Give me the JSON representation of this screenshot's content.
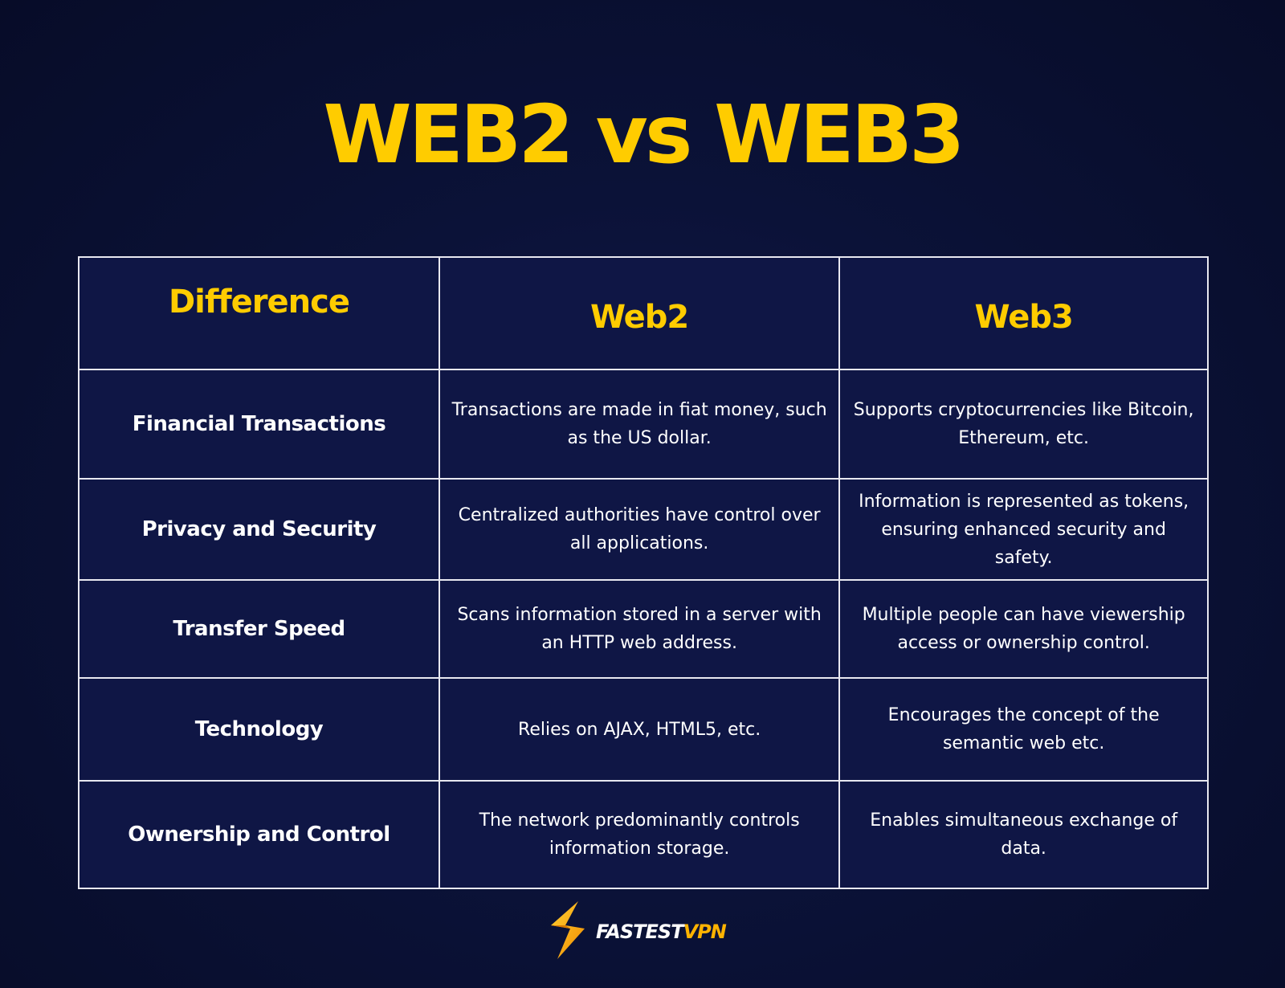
{
  "title": "WEB2 vs WEB3",
  "table": {
    "headers": [
      "Difference",
      "Web2",
      "Web3"
    ],
    "rows": [
      {
        "difference": "Financial Transactions",
        "web2": "Transactions are made in fiat money, such as the US dollar.",
        "web3": "Supports cryptocurrencies like Bitcoin, Ethereum, etc."
      },
      {
        "difference": "Privacy and Security",
        "web2": "Centralized authorities have control over all applications.",
        "web3": "Information is represented as tokens, ensuring enhanced security and safety."
      },
      {
        "difference": "Transfer Speed",
        "web2": "Scans information stored in a server with an HTTP web address.",
        "web3": "Multiple people can have viewership access or ownership control."
      },
      {
        "difference": "Technology",
        "web2": "Relies on AJAX, HTML5, etc.",
        "web3": "Encourages the concept of the semantic web etc."
      },
      {
        "difference": "Ownership and Control",
        "web2": "The network predominantly controls information storage.",
        "web3": "Enables simultaneous exchange of data."
      }
    ]
  },
  "logo": {
    "icon": "lightning-bolt-icon",
    "text_part1": "FASTEST",
    "text_part2": "VPN"
  },
  "colors": {
    "accent": "#ffcc00",
    "background": "#0b1238",
    "text": "#ffffff"
  }
}
